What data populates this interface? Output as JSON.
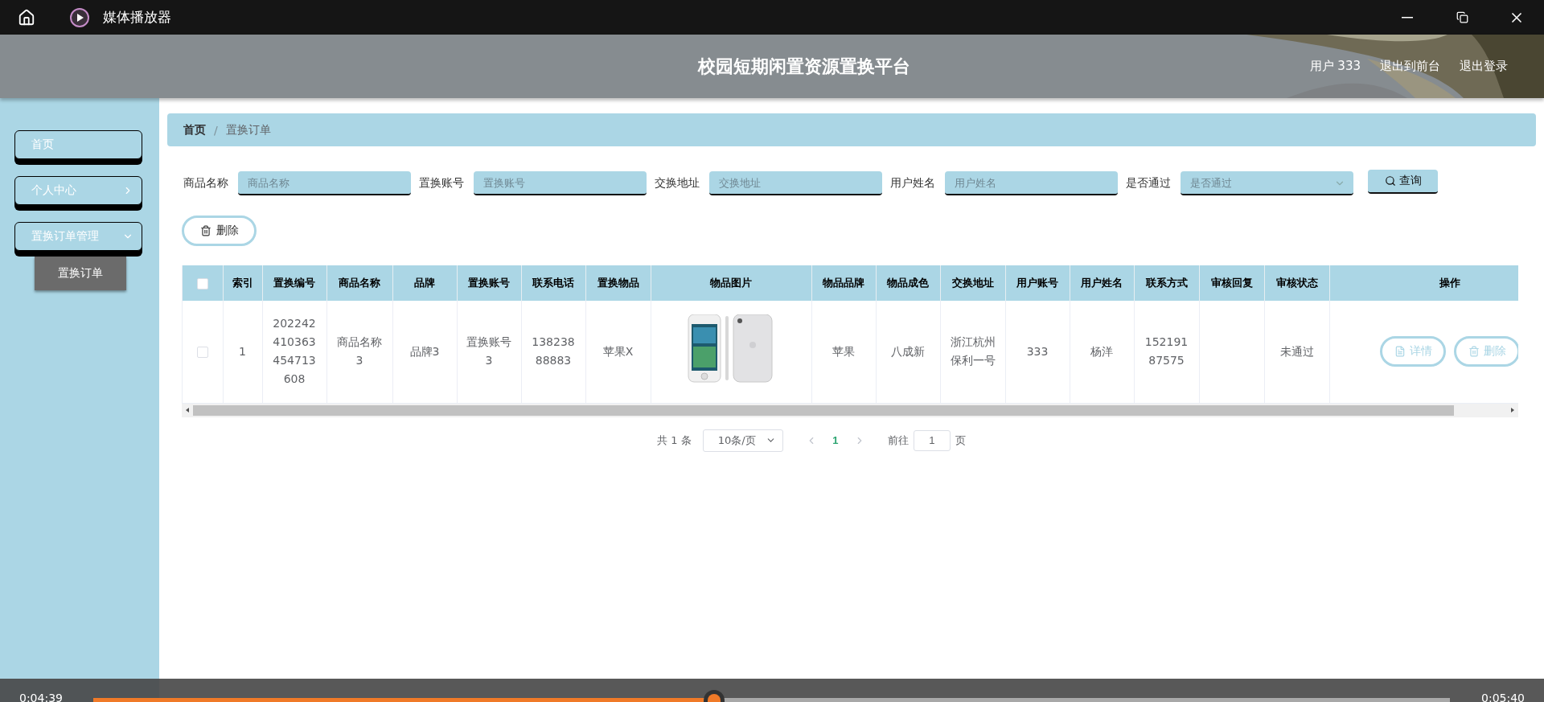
{
  "player": {
    "title": "媒体播放器",
    "elapsed": "0:04:39",
    "total": "0:05:40",
    "level": 0.45
  },
  "site": {
    "title": "校园短期闲置资源置换平台",
    "user": "用户 333",
    "links": [
      "退出到前台",
      "退出登录"
    ]
  },
  "sidebar": {
    "items": [
      {
        "label": "首页",
        "kind": "link",
        "selected": false
      },
      {
        "label": "个人中心",
        "kind": "group",
        "expanded": false,
        "selected": false
      },
      {
        "label": "置换订单管理",
        "kind": "group",
        "expanded": true,
        "selected": false,
        "children": [
          {
            "label": "置换订单",
            "kind": "link",
            "selected": true
          }
        ]
      }
    ]
  },
  "breadcrumb": {
    "items": [
      "首页",
      "置换订单"
    ],
    "separator": "/"
  },
  "filters": [
    {
      "label": "商品名称",
      "placeholder": "商品名称",
      "kind": "input"
    },
    {
      "label": "置换账号",
      "placeholder": "置换账号",
      "kind": "input"
    },
    {
      "label": "交换地址",
      "placeholder": "交换地址",
      "kind": "input"
    },
    {
      "label": "用户姓名",
      "placeholder": "用户姓名",
      "kind": "input"
    },
    {
      "label": "是否通过",
      "placeholder": "是否通过",
      "kind": "select"
    }
  ],
  "search_button": "查询",
  "delete_button": "删除",
  "table": {
    "select_all": {
      "checked": false
    },
    "columns": [
      "索引",
      "置换编号",
      "商品名称",
      "品牌",
      "置换账号",
      "联系电话",
      "置换物品",
      "物品图片",
      "物品品牌",
      "物品成色",
      "交换地址",
      "用户账号",
      "用户姓名",
      "联系方式",
      "审核回复",
      "审核状态",
      "操作"
    ],
    "rows": [
      {
        "checked": false,
        "cells": [
          {
            "kind": "text",
            "text": "1"
          },
          {
            "kind": "text",
            "text": "202242410363454713608"
          },
          {
            "kind": "text",
            "text": "商品名称3"
          },
          {
            "kind": "text",
            "text": "品牌3"
          },
          {
            "kind": "text",
            "text": "置换账号3"
          },
          {
            "kind": "text",
            "text": "13823888883"
          },
          {
            "kind": "text",
            "text": "苹果X"
          },
          {
            "kind": "picture"
          },
          {
            "kind": "text",
            "text": "苹果"
          },
          {
            "kind": "text",
            "text": "八成新"
          },
          {
            "kind": "text",
            "text": "浙江杭州保利一号"
          },
          {
            "kind": "text",
            "text": "333"
          },
          {
            "kind": "text",
            "text": "杨洋"
          },
          {
            "kind": "text",
            "text": "15219187575"
          },
          {
            "kind": "blank"
          },
          {
            "kind": "text",
            "text": "未通过"
          },
          {
            "kind": "actions",
            "actions": [
              {
                "label": "详情",
                "kind": "detail"
              },
              {
                "label": "删除",
                "kind": "delete"
              }
            ]
          }
        ]
      }
    ]
  },
  "pagination": {
    "total": "共 1 条",
    "page_size": "10条/页",
    "pages": [
      {
        "label": "1",
        "selected": true
      }
    ],
    "goto_label": "前往",
    "goto_value": "1",
    "page_unit": "页"
  }
}
